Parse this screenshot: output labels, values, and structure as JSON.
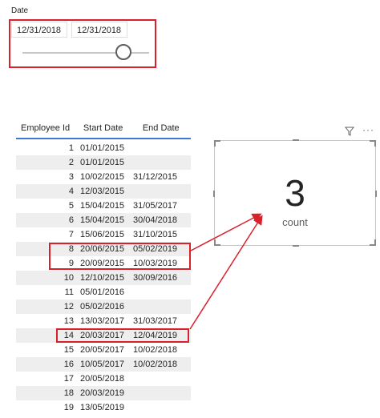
{
  "slicer": {
    "title": "Date",
    "start_date": "12/31/2018",
    "end_date": "12/31/2018",
    "slider_position": 0.88
  },
  "table": {
    "headers": [
      "Employee Id",
      "Start Date",
      "End Date"
    ],
    "rows": [
      [
        "1",
        "01/01/2015",
        ""
      ],
      [
        "2",
        "01/01/2015",
        ""
      ],
      [
        "3",
        "10/02/2015",
        "31/12/2015"
      ],
      [
        "4",
        "12/03/2015",
        ""
      ],
      [
        "5",
        "15/04/2015",
        "31/05/2017"
      ],
      [
        "6",
        "15/04/2015",
        "30/04/2018"
      ],
      [
        "7",
        "15/06/2015",
        "31/10/2015"
      ],
      [
        "8",
        "20/06/2015",
        "05/02/2019"
      ],
      [
        "9",
        "20/09/2015",
        "10/03/2019"
      ],
      [
        "10",
        "12/10/2015",
        "30/09/2016"
      ],
      [
        "11",
        "05/01/2016",
        ""
      ],
      [
        "12",
        "05/02/2016",
        ""
      ],
      [
        "13",
        "13/03/2017",
        "31/03/2017"
      ],
      [
        "14",
        "20/03/2017",
        "12/04/2019"
      ],
      [
        "15",
        "20/05/2017",
        "10/02/2018"
      ],
      [
        "16",
        "10/05/2017",
        "10/02/2018"
      ],
      [
        "17",
        "20/05/2018",
        ""
      ],
      [
        "18",
        "20/03/2019",
        ""
      ],
      [
        "19",
        "13/05/2019",
        ""
      ]
    ]
  },
  "card": {
    "value": "3",
    "label": "count"
  },
  "icons": {
    "filter": "filter-icon",
    "more": "more-options-icon"
  },
  "colors": {
    "highlight": "#d9212c",
    "header_underline": "#3c78d8",
    "alt_row": "#eeeeee"
  }
}
